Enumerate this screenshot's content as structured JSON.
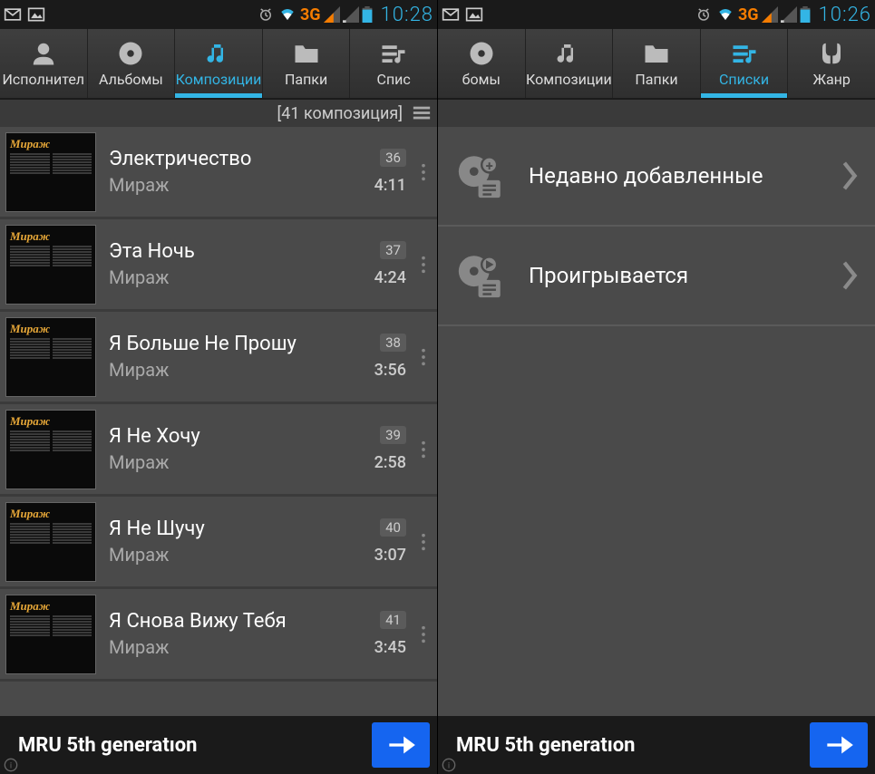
{
  "left": {
    "status": {
      "time": "10:28",
      "net": "3G"
    },
    "tabs": [
      {
        "id": "artists",
        "label": "Исполнител"
      },
      {
        "id": "albums",
        "label": "Альбомы"
      },
      {
        "id": "tracks",
        "label": "Композиции",
        "active": true
      },
      {
        "id": "folders",
        "label": "Папки"
      },
      {
        "id": "lists",
        "label": "Спис"
      }
    ],
    "count_label": "[41 композиция]",
    "tracks": [
      {
        "num": "36",
        "title": "Электричество",
        "artist": "Мираж",
        "dur": "4:11"
      },
      {
        "num": "37",
        "title": "Эта Ночь",
        "artist": "Мираж",
        "dur": "4:24"
      },
      {
        "num": "38",
        "title": "Я Больше Не Прошу",
        "artist": "Мираж",
        "dur": "3:56"
      },
      {
        "num": "39",
        "title": "Я Не Хочу",
        "artist": "Мираж",
        "dur": "2:58"
      },
      {
        "num": "40",
        "title": "Я Не Шучу",
        "artist": "Мираж",
        "dur": "3:07"
      },
      {
        "num": "41",
        "title": "Я Снова Вижу Тебя",
        "artist": "Мираж",
        "dur": "3:45"
      }
    ],
    "album_cover_title": "Мираж",
    "now_playing": "MRU 5th generatıon"
  },
  "right": {
    "status": {
      "time": "10:26",
      "net": "3G"
    },
    "tabs": [
      {
        "id": "albums",
        "label": "бомы"
      },
      {
        "id": "tracks",
        "label": "Композиции"
      },
      {
        "id": "folders",
        "label": "Папки"
      },
      {
        "id": "lists",
        "label": "Списки",
        "active": true
      },
      {
        "id": "genre",
        "label": "Жанр"
      }
    ],
    "playlists": [
      {
        "id": "recent",
        "label": "Недавно добавленные"
      },
      {
        "id": "playing",
        "label": "Проигрывается"
      }
    ],
    "now_playing": "MRU 5th generatıon"
  }
}
